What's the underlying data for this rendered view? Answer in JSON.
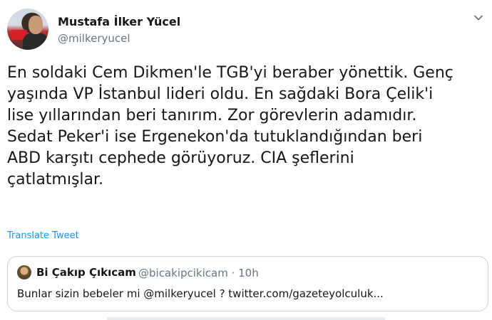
{
  "author": {
    "display_name": "Mustafa İlker Yücel",
    "handle": "@milkeryucel"
  },
  "tweet": {
    "text": "En soldaki Cem Dikmen'le TGB'yi beraber yönettik. Genç\nyaşında VP İstanbul lideri oldu. En sağdaki Bora Çelik'i\nlise yıllarından beri tanırım. Zor görevlerin adamıdır.\nSedat Peker'i ise Ergenekon'da tutuklandığından beri\nABD karşıtı cephede görüyoruz. CIA şeflerini\nçatlatmışlar.",
    "translate_label": "Translate Tweet"
  },
  "quoted_tweet": {
    "display_name": "Bi Çakıp Çıkıcam",
    "meta": "@bicakipcikicam · 10h",
    "text": "Bunlar sizin bebeler mi @milkeryucel ? twitter.com/gazeteyolculuk..."
  },
  "colors": {
    "link": "#1b95e0",
    "secondary_text": "#657786",
    "border": "#ccd6dd"
  },
  "icons": {
    "more": "chevron-down-icon"
  }
}
